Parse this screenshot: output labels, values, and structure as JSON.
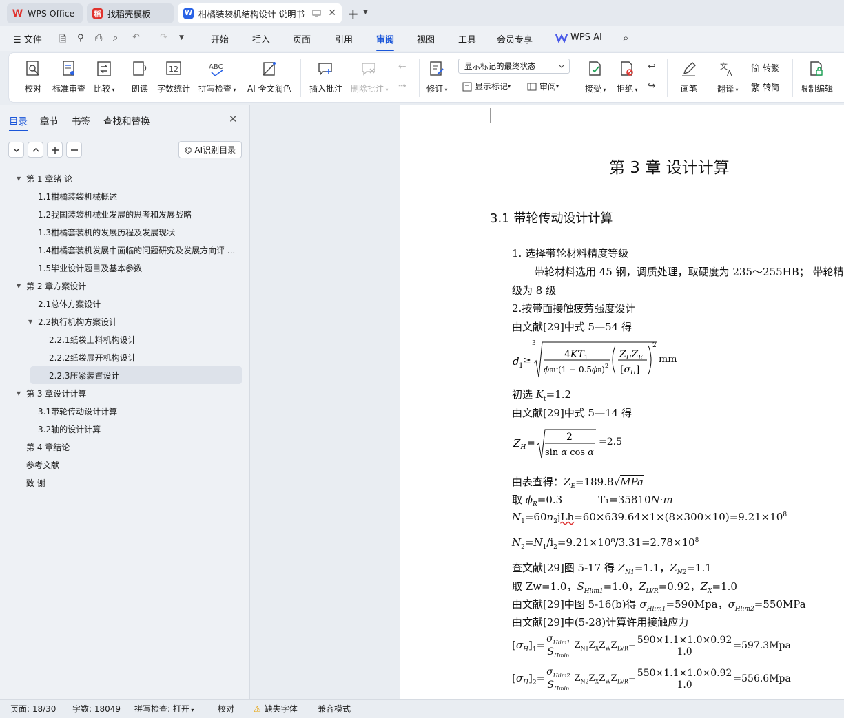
{
  "tabs": [
    {
      "label": "WPS Office",
      "color": "#e0322d",
      "icon": "W"
    },
    {
      "label": "找稻壳模板",
      "color": "#e0322d",
      "icon": "稻"
    },
    {
      "label": "柑橘装袋机结构设计 说明书",
      "color": "#2a63e6",
      "icon": "W"
    }
  ],
  "menu": {
    "file": "文件",
    "items": [
      "开始",
      "插入",
      "页面",
      "引用",
      "审阅",
      "视图",
      "工具",
      "会员专享"
    ],
    "active": "审阅",
    "wps_ai": "WPS AI"
  },
  "ribbon": {
    "proof": "校对",
    "std_review": "标准审查",
    "compare": "比较",
    "read": "朗读",
    "word_count": "字数统计",
    "spell": "拼写检查",
    "ai_polish": "AI 全文润色",
    "insert_comment": "插入批注",
    "delete_comment": "删除批注",
    "revise": "修订",
    "markup_select": "显示标记的最终状态",
    "show_markup": "显示标记",
    "review_pane": "审阅",
    "accept": "接受",
    "reject": "拒绝",
    "pen": "画笔",
    "translate": "翻译",
    "to_trad": "转繁",
    "to_simp": "转简",
    "restrict": "限制编辑"
  },
  "nav": {
    "tabs": [
      "目录",
      "章节",
      "书签",
      "查找和替换"
    ],
    "ai_toc": "AI识别目录"
  },
  "toc": [
    {
      "text": "第 1 章绪  论",
      "level": 0,
      "exp": true
    },
    {
      "text": "1.1柑橘装袋机械概述",
      "level": 1
    },
    {
      "text": "1.2我国装袋机械业发展的思考和发展战略",
      "level": 1
    },
    {
      "text": "1.3柑橘套装机的发展历程及发展现状",
      "level": 1
    },
    {
      "text": "1.4柑橘套装机发展中面临的问题研究及发展方向评 ...",
      "level": 1
    },
    {
      "text": "1.5毕业设计题目及基本参数",
      "level": 1
    },
    {
      "text": "第 2 章方案设计",
      "level": 0,
      "exp": true
    },
    {
      "text": "2.1总体方案设计",
      "level": 1
    },
    {
      "text": "2.2执行机构方案设计",
      "level": 1,
      "exp": true
    },
    {
      "text": "2.2.1纸袋上料机构设计",
      "level": 2
    },
    {
      "text": "2.2.2纸袋展开机构设计",
      "level": 2
    },
    {
      "text": "2.2.3压紧装置设计",
      "level": 2,
      "sel": true
    },
    {
      "text": "第 3 章设计计算",
      "level": 0,
      "exp": true
    },
    {
      "text": "3.1带轮传动设计计算",
      "level": 1
    },
    {
      "text": "3.2轴的设计计算",
      "level": 1
    },
    {
      "text": "第 4 章结论",
      "level": 0
    },
    {
      "text": "参考文献",
      "level": 0
    },
    {
      "text": "致  谢",
      "level": 0
    }
  ],
  "doc": {
    "chapter": "第 3 章  设计计算",
    "section": "3.1  带轮传动设计计算",
    "l1": "1. 选择带轮材料精度等级",
    "l2": "带轮材料选用 45 钢，调质处理，取硬度为 235～255HB；  带轮精",
    "l3": "级为 8 级",
    "l4": "2.按带面接触疲劳强度设计",
    "l5": "由文献[29]中式 5—54 得",
    "mm": "mm",
    "l6a": "初选 ",
    "l6b": "=1.2",
    "l7": "由文献[29]中式 5—14 得",
    "zh_val": "=2.5",
    "l8a": "由表查得：",
    "l8b": "=189.8",
    "l9a": "取 ",
    "l9b": "=0.3",
    "l9c": "T₁=35810",
    "l10": "=60×639.64×1×(8×300×10)=9.21×10",
    "l11": "=9.21×10⁸/3.31=2.78×10",
    "l12a": "查文献[29]图 5-17 得 ",
    "l12b": "=1.1，",
    "l12c": "=1.1",
    "l13a": "取 Zw=1.0，",
    "l13b": "=1.0，",
    "l13c": "=0.92，",
    "l13d": "=1.0",
    "l14a": "由文献[29]中图 5-16(b)得 ",
    "l14b": "=590Mpa，",
    "l14c": "=550MPa",
    "l15": "由文献[29]中(5-28)计算许用接触应力",
    "f1_num": "590×1.1×1.0×0.92",
    "f1_den": "1.0",
    "f1_res": "=597.3Mpa",
    "f2_num": "550×1.1×1.0×0.92",
    "f2_den": "1.0",
    "f2_res": "=556.6Mpa"
  },
  "status": {
    "page": "页面: 18/30",
    "words": "字数: 18049",
    "spell": "拼写检查: 打开",
    "proof": "校对",
    "missing_font": "缺失字体",
    "compat": "兼容模式"
  }
}
